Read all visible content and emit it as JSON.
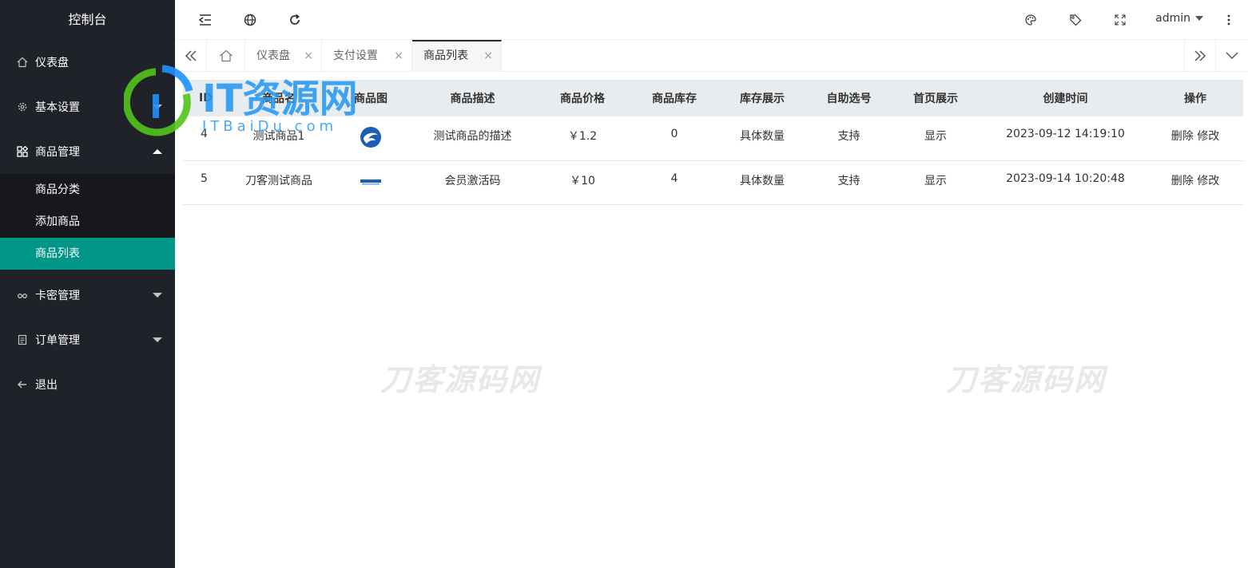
{
  "sidebar": {
    "title": "控制台",
    "items": [
      {
        "label": "仪表盘",
        "icon": "home-icon"
      },
      {
        "label": "基本设置",
        "icon": "gear-icon"
      },
      {
        "label": "商品管理",
        "icon": "apps-icon"
      },
      {
        "label": "卡密管理",
        "icon": "link-icon"
      },
      {
        "label": "订单管理",
        "icon": "clipboard-icon"
      },
      {
        "label": "退出",
        "icon": "arrow-left-icon"
      }
    ],
    "submenu": [
      {
        "label": "商品分类"
      },
      {
        "label": "添加商品"
      },
      {
        "label": "商品列表",
        "active": true
      }
    ]
  },
  "header": {
    "user": "admin",
    "icons": [
      "menu-shrink-icon",
      "globe-icon",
      "refresh-icon",
      "palette-icon",
      "tag-icon",
      "fullscreen-icon",
      "more-vertical-icon"
    ]
  },
  "tabs": {
    "items": [
      {
        "label": "仪表盘",
        "close": "×"
      },
      {
        "label": "支付设置",
        "close": "×"
      },
      {
        "label": "商品列表",
        "close": "×",
        "active": true
      }
    ]
  },
  "table": {
    "headers": [
      "ID",
      "商品名",
      "商品图",
      "商品描述",
      "商品价格",
      "商品库存",
      "库存展示",
      "自助选号",
      "首页展示",
      "创建时间",
      "操作"
    ],
    "rows": [
      {
        "id": "4",
        "name": "测试商品1",
        "desc": "测试商品的描述",
        "price": "￥1.2",
        "stock": "0",
        "stock_display": "具体数量",
        "self_select": "支持",
        "home_display": "显示",
        "created": "2023-09-12 14:19:10",
        "delete": "删除",
        "edit": "修改"
      },
      {
        "id": "5",
        "name": "刀客测试商品",
        "desc": "会员激活码",
        "price": "￥10",
        "stock": "4",
        "stock_display": "具体数量",
        "self_select": "支持",
        "home_display": "显示",
        "created": "2023-09-14 10:20:48",
        "delete": "删除",
        "edit": "修改"
      }
    ]
  },
  "watermark": {
    "logo_text": "IT资源网",
    "logo_sub": "ITBaiDu.com",
    "text": "刀客源码网"
  },
  "colors": {
    "sidebar_bg": "#20222a",
    "submenu_bg": "#17181e",
    "active": "#009688"
  }
}
